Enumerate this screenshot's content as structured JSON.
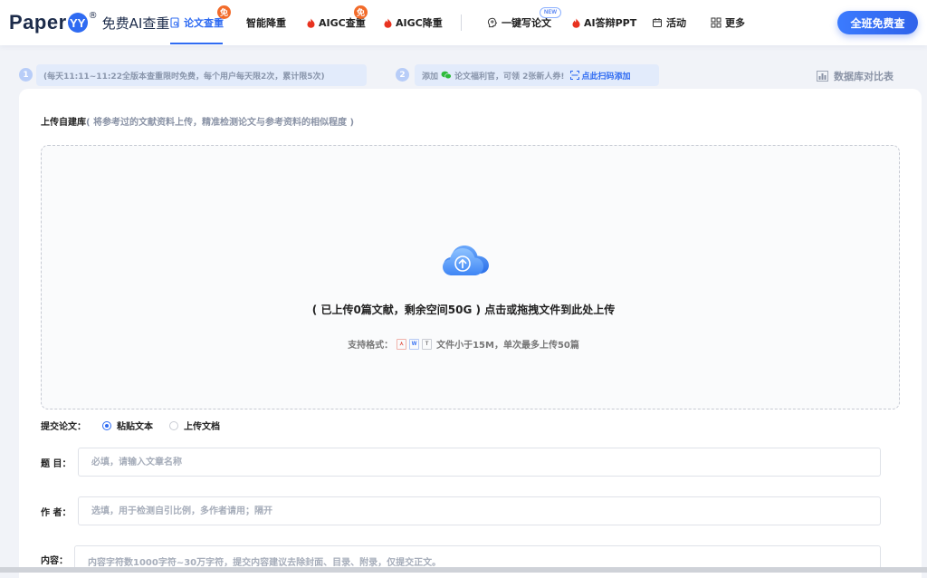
{
  "brand": {
    "logo_text": "Paper",
    "logo_mark": "YY",
    "reg": "®",
    "slogan": "免费AI查重"
  },
  "nav": {
    "items": [
      {
        "label": "论文查重",
        "icon": "doc-search-icon",
        "active": true,
        "badge": "免"
      },
      {
        "label": "智能降重"
      },
      {
        "label": "AIGC查重",
        "icon": "flame-icon",
        "badge": "免"
      },
      {
        "label": "AIGC降重",
        "icon": "flame-icon"
      },
      {
        "label": "一键写论文",
        "icon": "brain-icon",
        "badge": "NEW"
      },
      {
        "label": "AI答辩PPT",
        "icon": "flame-icon"
      },
      {
        "label": "活动",
        "icon": "calendar-icon"
      },
      {
        "label": "更多",
        "icon": "grid-icon"
      }
    ],
    "cta": "全班免费查"
  },
  "notices": [
    {
      "step": "1",
      "text": "(每天11:11~11:22全版本查重限时免费，每个用户每天限2次，累计限5次)"
    },
    {
      "step": "2",
      "prefix": "添加",
      "mid": "论文福利官，可领 2张新人券!",
      "link": "点此扫码添加"
    }
  ],
  "compare_label": "数据库对比表",
  "upload": {
    "title": "上传自建库",
    "hint": "( 将参考过的文献资料上传，精准检测论文与参考资料的相似程度 )",
    "main_text": "( 已上传0篇文献，剩余空间50G ) 点击或拖拽文件到此处上传",
    "formats_label": "支持格式：",
    "format_icons": [
      "pdf-icon",
      "word-icon",
      "txt-icon"
    ],
    "limit_text": "文件小于15M，单次最多上传50篇"
  },
  "form": {
    "submit_label": "提交论文：",
    "options": [
      {
        "label": "粘贴文本",
        "checked": true
      },
      {
        "label": "上传文档",
        "checked": false
      }
    ],
    "title_label": "题 目：",
    "title_placeholder": "必填，请输入文章名称",
    "author_label": "作 者：",
    "author_placeholder": "选填，用于检测自引比例，多作者请用；隔开",
    "content_label": "内容：",
    "content_placeholder": "内容字符数1000字符~30万字符，提交内容建议去除封面、目录、附录，仅提交正文。"
  },
  "colors": {
    "accent": "#2f6bf2",
    "badge": "#f26b2a",
    "flame": "#e8321f"
  }
}
